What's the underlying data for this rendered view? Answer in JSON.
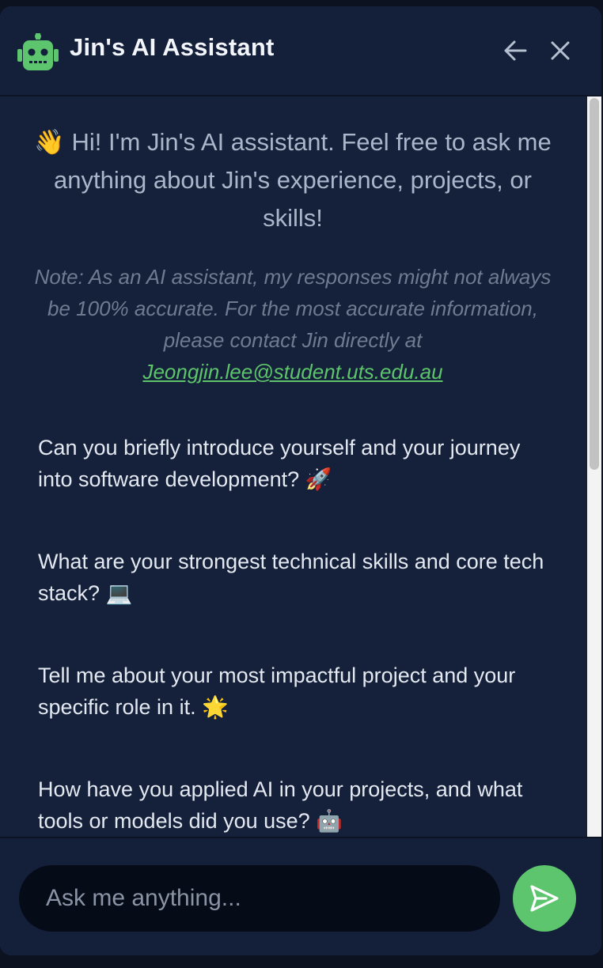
{
  "header": {
    "title": "Jin's AI Assistant",
    "icons": {
      "bot": "robot-icon",
      "back": "arrow-left-icon",
      "close": "close-icon"
    }
  },
  "chat": {
    "welcome": "👋 Hi! I'm Jin's AI assistant. Feel free to ask me anything about Jin's experience, projects, or skills!",
    "note_text": "Note: As an AI assistant, my responses might not always be 100% accurate. For the most accurate information, please contact Jin directly at",
    "note_email": "Jeongjin.lee@student.uts.edu.au",
    "suggestions": [
      "Can you briefly introduce yourself and your journey into software development? 🚀",
      "What are your strongest technical skills and core tech stack? 💻",
      "Tell me about your most impactful project and your specific role in it. 🌟",
      "How have you applied AI in your projects, and what tools or models did you use? 🤖"
    ]
  },
  "input": {
    "placeholder": "Ask me anything...",
    "value": ""
  },
  "colors": {
    "panel_bg": "#15213a",
    "accent_green": "#5cc56d",
    "input_bg": "#050b17"
  }
}
